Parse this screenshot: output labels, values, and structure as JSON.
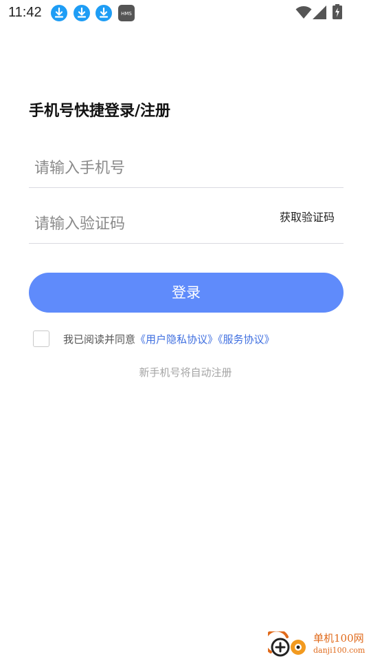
{
  "status_bar": {
    "time": "11:42",
    "notification_icons": [
      "download-icon",
      "download-icon",
      "download-icon",
      "hms-icon"
    ],
    "hms_label": "HMS",
    "system_icons": [
      "wifi-icon",
      "signal-icon",
      "battery-charging-icon"
    ]
  },
  "login": {
    "title": "手机号快捷登录/注册",
    "phone_placeholder": "请输入手机号",
    "code_placeholder": "请输入验证码",
    "get_code_label": "获取验证码",
    "login_button": "登录",
    "agree_prefix": "我已阅读并同意",
    "privacy_link": "《用户隐私协议》",
    "service_link": "《服务协议》",
    "agree_checked": false,
    "hint": "新手机号将自动注册"
  },
  "watermark": {
    "name": "单机100网",
    "url": "danji100.com"
  },
  "colors": {
    "primary": "#5f8bfb",
    "link": "#3f6fe0",
    "notification_icon": "#1e9df5",
    "watermark": "#e06a1b"
  }
}
